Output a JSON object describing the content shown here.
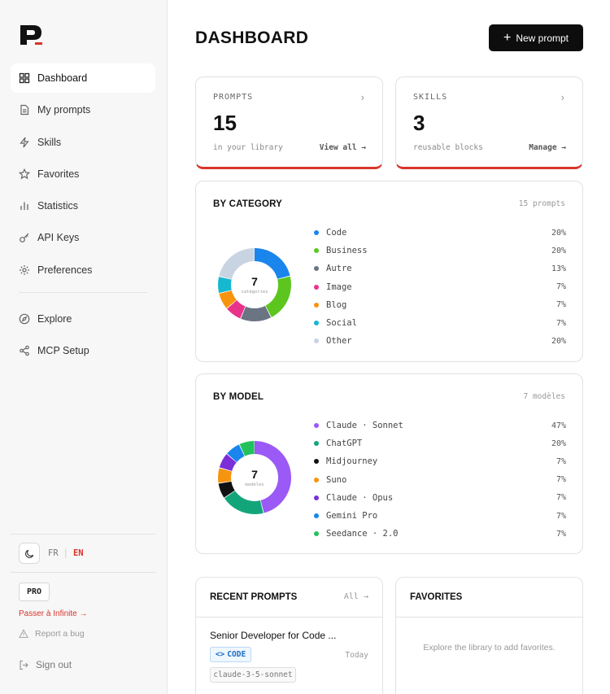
{
  "sidebar": {
    "items": [
      {
        "label": "Dashboard",
        "icon": "grid-icon",
        "active": true
      },
      {
        "label": "My prompts",
        "icon": "document-icon"
      },
      {
        "label": "Skills",
        "icon": "lightning-icon"
      },
      {
        "label": "Favorites",
        "icon": "star-icon"
      },
      {
        "label": "Statistics",
        "icon": "bar-chart-icon"
      },
      {
        "label": "API Keys",
        "icon": "key-icon"
      },
      {
        "label": "Preferences",
        "icon": "gear-icon"
      }
    ],
    "secondary": [
      {
        "label": "Explore",
        "icon": "compass-icon"
      },
      {
        "label": "MCP Setup",
        "icon": "share-icon"
      }
    ],
    "lang_fr": "FR",
    "lang_en": "EN",
    "pro_badge": "PRO",
    "upgrade_label": "Passer à Infinite →",
    "bug_label": "Report a bug",
    "signout_label": "Sign out"
  },
  "header": {
    "title": "DASHBOARD",
    "new_prompt_label": "New prompt"
  },
  "stats": {
    "prompts": {
      "label": "PROMPTS",
      "value": "15",
      "sub": "in your library",
      "link": "View all →"
    },
    "skills": {
      "label": "SKILLS",
      "value": "3",
      "sub": "reusable blocks",
      "link": "Manage →"
    }
  },
  "by_category": {
    "title": "BY CATEGORY",
    "count": "15 prompts",
    "center_value": "7",
    "center_label": "catégories",
    "items": [
      {
        "name": "Code",
        "pct": "20%",
        "value": 20,
        "color": "#1a85ec"
      },
      {
        "name": "Business",
        "pct": "20%",
        "value": 20,
        "color": "#5cc61f"
      },
      {
        "name": "Autre",
        "pct": "13%",
        "value": 13,
        "color": "#6b7482"
      },
      {
        "name": "Image",
        "pct": "7%",
        "value": 7,
        "color": "#e9338b"
      },
      {
        "name": "Blog",
        "pct": "7%",
        "value": 7,
        "color": "#f7940f"
      },
      {
        "name": "Social",
        "pct": "7%",
        "value": 7,
        "color": "#15b8cf"
      },
      {
        "name": "Other",
        "pct": "20%",
        "value": 20,
        "color": "#c9d4e2"
      }
    ]
  },
  "by_model": {
    "title": "BY MODEL",
    "count": "7 modèles",
    "center_value": "7",
    "center_label": "modèles",
    "items": [
      {
        "name": "Claude · Sonnet",
        "pct": "47%",
        "value": 47,
        "color": "#9b59f5"
      },
      {
        "name": "ChatGPT",
        "pct": "20%",
        "value": 20,
        "color": "#13a57a"
      },
      {
        "name": "Midjourney",
        "pct": "7%",
        "value": 7,
        "color": "#111111"
      },
      {
        "name": "Suno",
        "pct": "7%",
        "value": 7,
        "color": "#f7940f"
      },
      {
        "name": "Claude · Opus",
        "pct": "7%",
        "value": 7,
        "color": "#7c2fd8"
      },
      {
        "name": "Gemini Pro",
        "pct": "7%",
        "value": 7,
        "color": "#1a85ec"
      },
      {
        "name": "Seedance · 2.0",
        "pct": "7%",
        "value": 7,
        "color": "#22c25b"
      }
    ]
  },
  "recent": {
    "title": "RECENT PROMPTS",
    "all_link": "All →",
    "prompt_title": "Senior Developer for Code ...",
    "tag": "CODE",
    "tag_icon": "code-brackets-icon",
    "date": "Today",
    "model": "claude-3-5-sonnet"
  },
  "favorites": {
    "title": "FAVORITES",
    "empty": "Explore the library to add favorites."
  },
  "colors": {
    "accent": "#d9342b",
    "button_bg": "#0d0d0d"
  }
}
